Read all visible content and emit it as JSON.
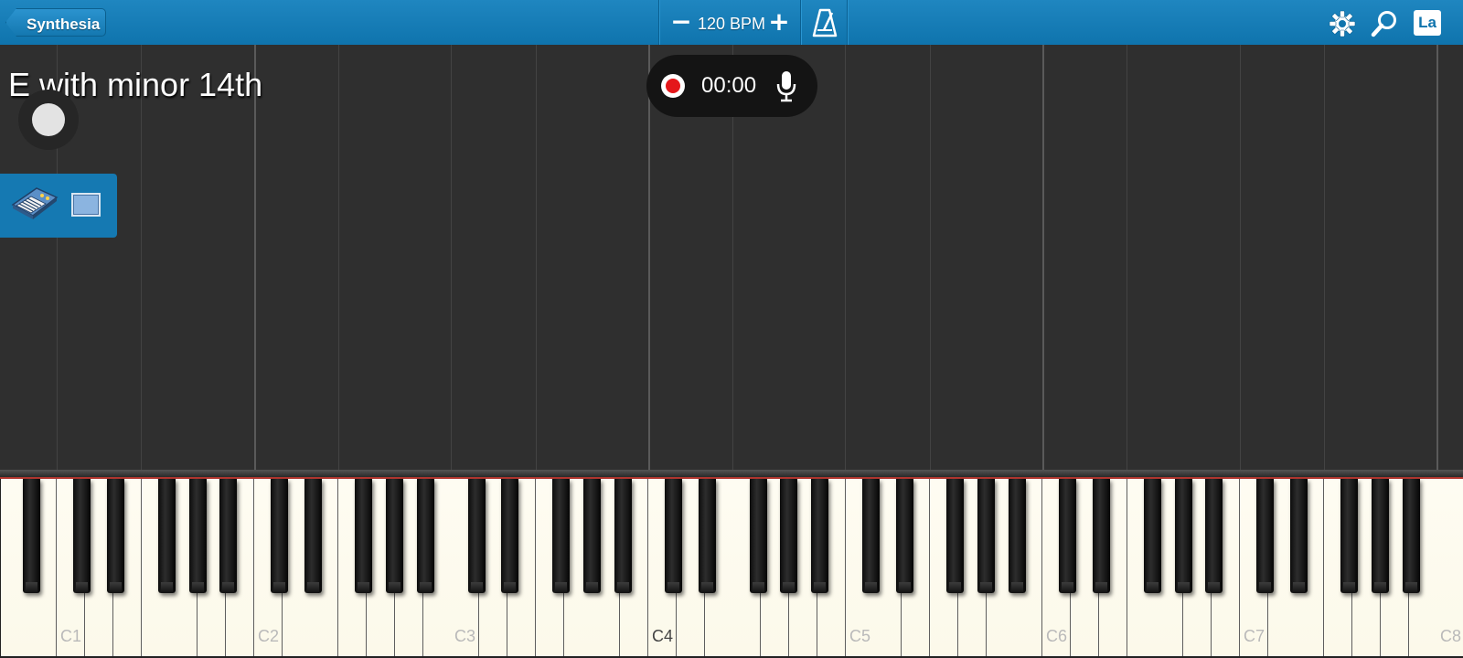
{
  "header": {
    "back_label": "Synthesia",
    "bpm_minus": "−",
    "bpm_text": "120 BPM",
    "bpm_plus": "+",
    "metronome_icon": "metronome-icon",
    "settings_icon": "gear-icon",
    "search_icon": "magnifier-icon",
    "label_toggle": "La"
  },
  "main": {
    "chord_label": "E with minor 14th",
    "recorder": {
      "timer": "00:00",
      "record_icon": "record-icon",
      "mic_icon": "microphone-icon"
    },
    "instrument_panel": {
      "instrument_icon": "synthesizer-icon",
      "view_icon": "screen-icon"
    }
  },
  "keyboard": {
    "octave_labels": [
      "C1",
      "C2",
      "C3",
      "C4",
      "C5",
      "C6",
      "C7",
      "C8"
    ],
    "highlighted_label": "C4"
  },
  "colors": {
    "topbar": "#1279b3",
    "background": "#2f2f2f",
    "white_key": "#fdfaee",
    "record": "#e4171a"
  }
}
